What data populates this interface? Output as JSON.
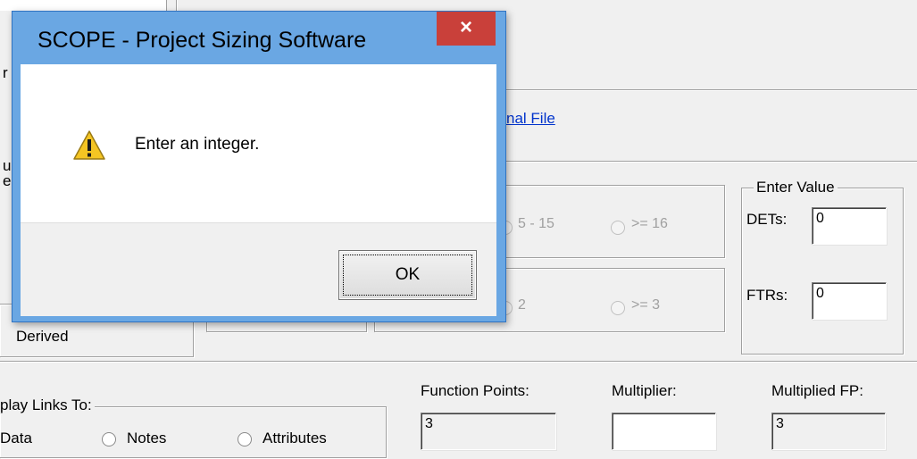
{
  "background": {
    "ilf_link": "nal File",
    "det_group": {
      "label": "Enter Value",
      "dets_label": "DETs:",
      "dets_value": "0",
      "ftrs_label": "FTRs:",
      "ftrs_value": "0"
    },
    "det_range_options": [
      "5 - 15",
      ">= 16"
    ],
    "ftr_range_options": [
      "2",
      ">= 3"
    ],
    "left_partial_items": [
      "r",
      "u",
      "e",
      "Derived"
    ],
    "display_links": {
      "label": "play Links To:",
      "options": [
        "Data",
        "Notes",
        "Attributes"
      ]
    },
    "function_points": {
      "label": "Function Points:",
      "value": "3"
    },
    "multiplier": {
      "label": "Multiplier:",
      "value": ""
    },
    "multiplied_fp": {
      "label": "Multiplied FP:",
      "value": "3"
    }
  },
  "dialog": {
    "title": "SCOPE - Project Sizing Software",
    "close_glyph": "×",
    "icon": "warning-icon",
    "message": "Enter an integer.",
    "ok_label": "OK"
  },
  "colors": {
    "window_frame": "#6aa7e3",
    "close_button": "#c9403a",
    "link": "#0033cc",
    "warning_yellow": "#f5c523"
  }
}
